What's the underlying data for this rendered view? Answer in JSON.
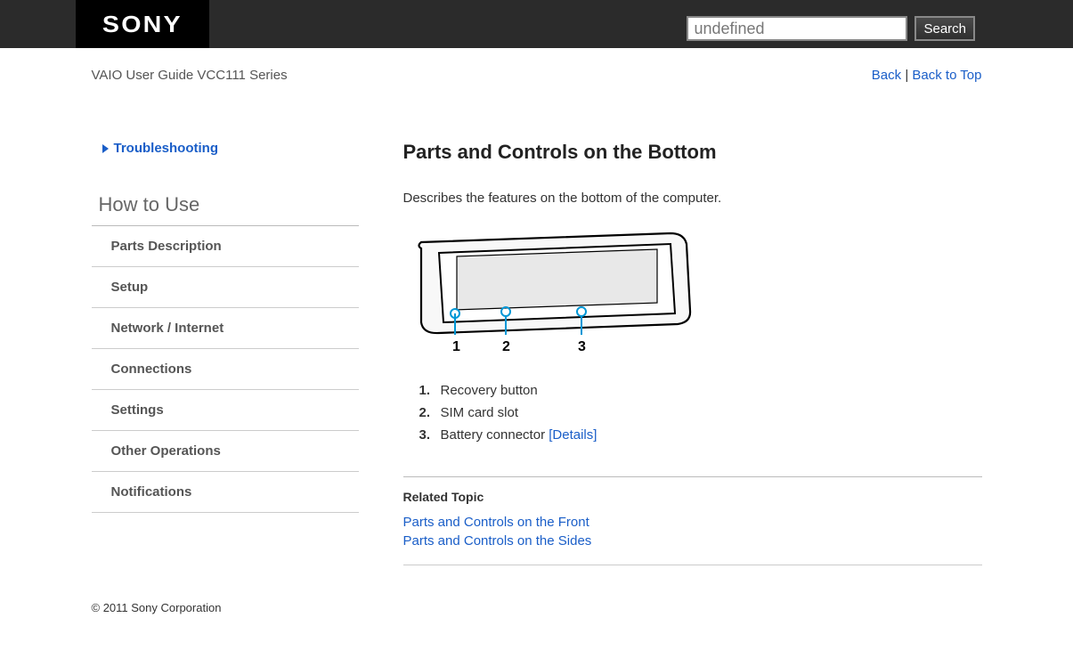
{
  "logo": "SONY",
  "search": {
    "placeholder": "undefined",
    "button": "Search"
  },
  "guide_title": "VAIO User Guide VCC111 Series",
  "back_links": {
    "back": "Back",
    "top": "Back to Top",
    "sep": " | "
  },
  "sidebar": {
    "troubleshooting": "Troubleshooting",
    "howto_heading": "How to Use",
    "nav": [
      "Parts Description",
      "Setup",
      "Network / Internet",
      "Connections",
      "Settings",
      "Other Operations",
      "Notifications"
    ]
  },
  "content": {
    "title": "Parts and Controls on the Bottom",
    "intro": "Describes the features on the bottom of the computer.",
    "parts": [
      {
        "label": "Recovery button",
        "details": ""
      },
      {
        "label": "SIM card slot",
        "details": ""
      },
      {
        "label": "Battery connector ",
        "details": "[Details]"
      }
    ],
    "related_heading": "Related Topic",
    "related": [
      "Parts and Controls on the Front",
      "Parts and Controls on the Sides"
    ]
  },
  "footer": "© 2011 Sony Corporation"
}
